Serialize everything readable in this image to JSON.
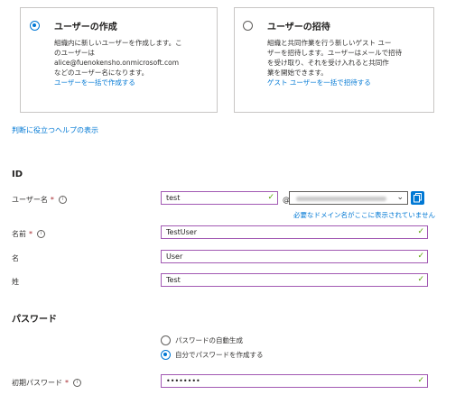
{
  "cards": {
    "create": {
      "title": "ユーザーの作成",
      "lines": [
        "組織内に新しいユーザーを作成します。こ",
        "のユーザーは",
        "alice@fuenokensho.onmicrosoft.com",
        "などのユーザー名になります。"
      ],
      "link": "ユーザーを一括で作成する",
      "selected": true
    },
    "invite": {
      "title": "ユーザーの招待",
      "lines": [
        "組織と共同作業を行う新しいゲスト ユー",
        "ザーを招待します。ユーザーはメールで招待",
        "を受け取り、それを受け入れると共同作",
        "業を開始できます。"
      ],
      "link": "ゲスト ユーザーを一括で招待する",
      "selected": false
    }
  },
  "help_link": "判断に役立つヘルプの表示",
  "identity": {
    "section_title": "ID",
    "username_label": "ユーザー名",
    "username_value": "test",
    "at": "@",
    "domain_hint": "必要なドメイン名がここに表示されていません",
    "name_label": "名前",
    "name_value": "TestUser",
    "first_label": "名",
    "first_value": "User",
    "last_label": "姓",
    "last_value": "Test",
    "required_mark": "*",
    "info_glyph": "i",
    "check_glyph": "✓"
  },
  "password": {
    "section_title": "パスワード",
    "auto_option": "パスワードの自動生成",
    "manual_option": "自分でパスワードを作成する",
    "manual_selected": true,
    "initial_label": "初期パスワード",
    "initial_value": "••••••••"
  }
}
